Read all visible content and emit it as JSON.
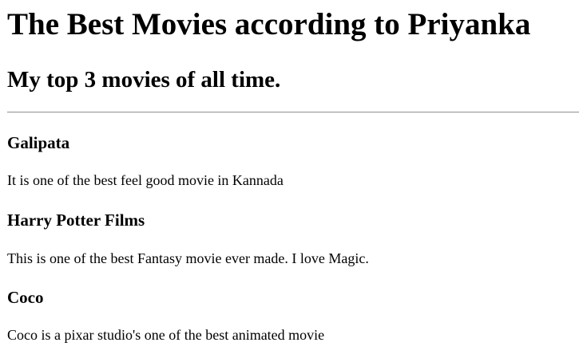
{
  "heading": "The Best Movies according to Priyanka",
  "subheading": "My top 3 movies of all time.",
  "movies": [
    {
      "title": "Galipata",
      "description": "It is one of the best feel good movie in Kannada"
    },
    {
      "title": "Harry Potter Films",
      "description": "This is one of the best Fantasy movie ever made. I love Magic."
    },
    {
      "title": "Coco",
      "description": "Coco is a pixar studio's one of the best animated movie"
    }
  ]
}
